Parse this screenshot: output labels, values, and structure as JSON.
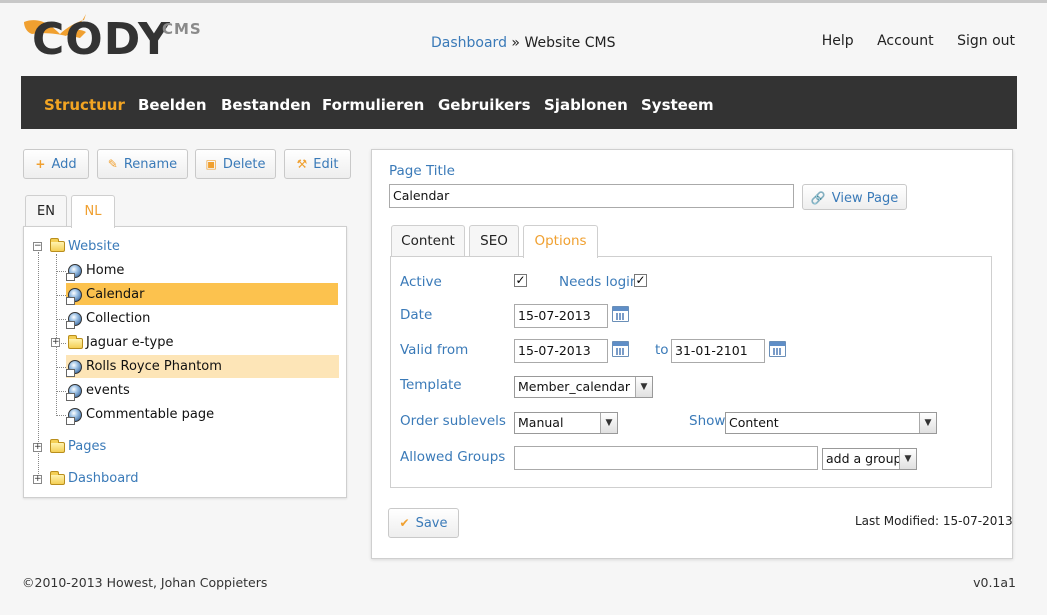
{
  "header": {
    "logo_text": "CODY",
    "logo_suffix": "CMS",
    "breadcrumb_link": "Dashboard",
    "breadcrumb_sep": "»",
    "breadcrumb_current": "Website CMS",
    "links": [
      "Help",
      "Account",
      "Sign out"
    ]
  },
  "nav": {
    "items": [
      "Structuur",
      "Beelden",
      "Bestanden",
      "Formulieren",
      "Gebruikers",
      "Sjablonen",
      "Systeem"
    ],
    "active": "Structuur",
    "accent_color": "#f3a523",
    "bar_color": "#333333"
  },
  "toolbar": {
    "add": "Add",
    "rename": "Rename",
    "delete": "Delete",
    "edit": "Edit",
    "add_icon": "plus-icon",
    "rename_icon": "pencil-icon",
    "delete_icon": "trash-icon",
    "edit_icon": "wrench-icon"
  },
  "lang_tabs": [
    "EN",
    "NL"
  ],
  "lang_active": "NL",
  "tree": {
    "root": "Website",
    "children": [
      "Home",
      "Calendar",
      "Collection",
      "Jaguar e-type",
      "Rolls Royce Phantom",
      "events",
      "Commentable page"
    ],
    "selected": "Calendar",
    "hovered": "Rolls Royce Phantom",
    "others": [
      "Pages",
      "Dashboard"
    ]
  },
  "page": {
    "title_label": "Page Title",
    "title_value": "Calendar",
    "view_page": "View Page"
  },
  "subtabs": [
    "Content",
    "SEO",
    "Options"
  ],
  "subtab_active": "Options",
  "options": {
    "active_label": "Active",
    "active_checked": true,
    "needs_login_label": "Needs login",
    "needs_login_checked": true,
    "date_label": "Date",
    "date_value": "15-07-2013",
    "valid_from_label": "Valid from",
    "valid_from_value": "15-07-2013",
    "to_label": "to",
    "valid_to_value": "31-01-2101",
    "template_label": "Template",
    "template_value": "Member_calendar",
    "order_label": "Order sublevels",
    "order_value": "Manual",
    "show_label": "Show",
    "show_value": "Content",
    "groups_label": "Allowed Groups",
    "groups_value": "",
    "add_group": "add a group"
  },
  "save": "Save",
  "last_modified": "Last Modified: 15-07-2013",
  "footer": {
    "copyright": "©2010-2013 Howest, Johan Coppieters",
    "version": "v0.1a1"
  }
}
